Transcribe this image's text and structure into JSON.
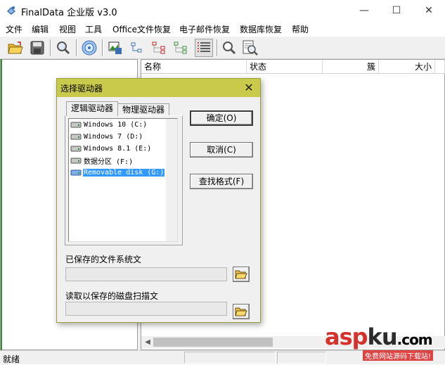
{
  "window": {
    "title": "FinalData 企业版 v3.0",
    "icon": "finaldata-app-icon",
    "controls": {
      "minimize": "—",
      "maximize": "☐",
      "close": "✕"
    }
  },
  "menu": {
    "items": [
      "文件",
      "编辑",
      "视图",
      "工具",
      "Office文件恢复",
      "电子邮件恢复",
      "数据库恢复",
      "帮助"
    ]
  },
  "toolbar": {
    "buttons": [
      "open-folder-icon",
      "save-disk-icon",
      "search-magnifier-icon",
      "drive-scan-icon",
      "image-view-icon",
      "tree-small-icon",
      "tree-dotted-red-icon",
      "tree-dotted-green-icon",
      "details-list-icon",
      "find-icon",
      "preview-icon"
    ]
  },
  "list": {
    "columns": [
      "名称",
      "状态",
      "簇",
      "大小"
    ]
  },
  "status": {
    "text": "就绪"
  },
  "dialog": {
    "title": "选择驱动器",
    "close": "✕",
    "tabs": [
      "逻辑驱动器",
      "物理驱动器"
    ],
    "drives": [
      {
        "label": "Windows 10 (C:)",
        "selected": false
      },
      {
        "label": "Windows 7 (D:)",
        "selected": false
      },
      {
        "label": "Windows 8.1 (E:)",
        "selected": false
      },
      {
        "label": "数据分区 (F:)",
        "selected": false
      },
      {
        "label": "Removable disk (G:)",
        "selected": true
      }
    ],
    "buttons": {
      "ok": "确定(O)",
      "cancel": "取消(C)",
      "find_format": "查找格式(F)"
    },
    "saved_fs_label": "已保存的文件系统文",
    "saved_fs_value": "",
    "saved_scan_label": "读取以保存的磁盘扫描文",
    "saved_scan_value": ""
  },
  "watermark": {
    "text_main": "aspku",
    "text_suffix": ".com",
    "text_sub": "免费网站源码下载站!",
    "colors": {
      "asp": "#d4312b",
      "ku": "#2b2b2b",
      "com": "#2b2b2b"
    }
  }
}
